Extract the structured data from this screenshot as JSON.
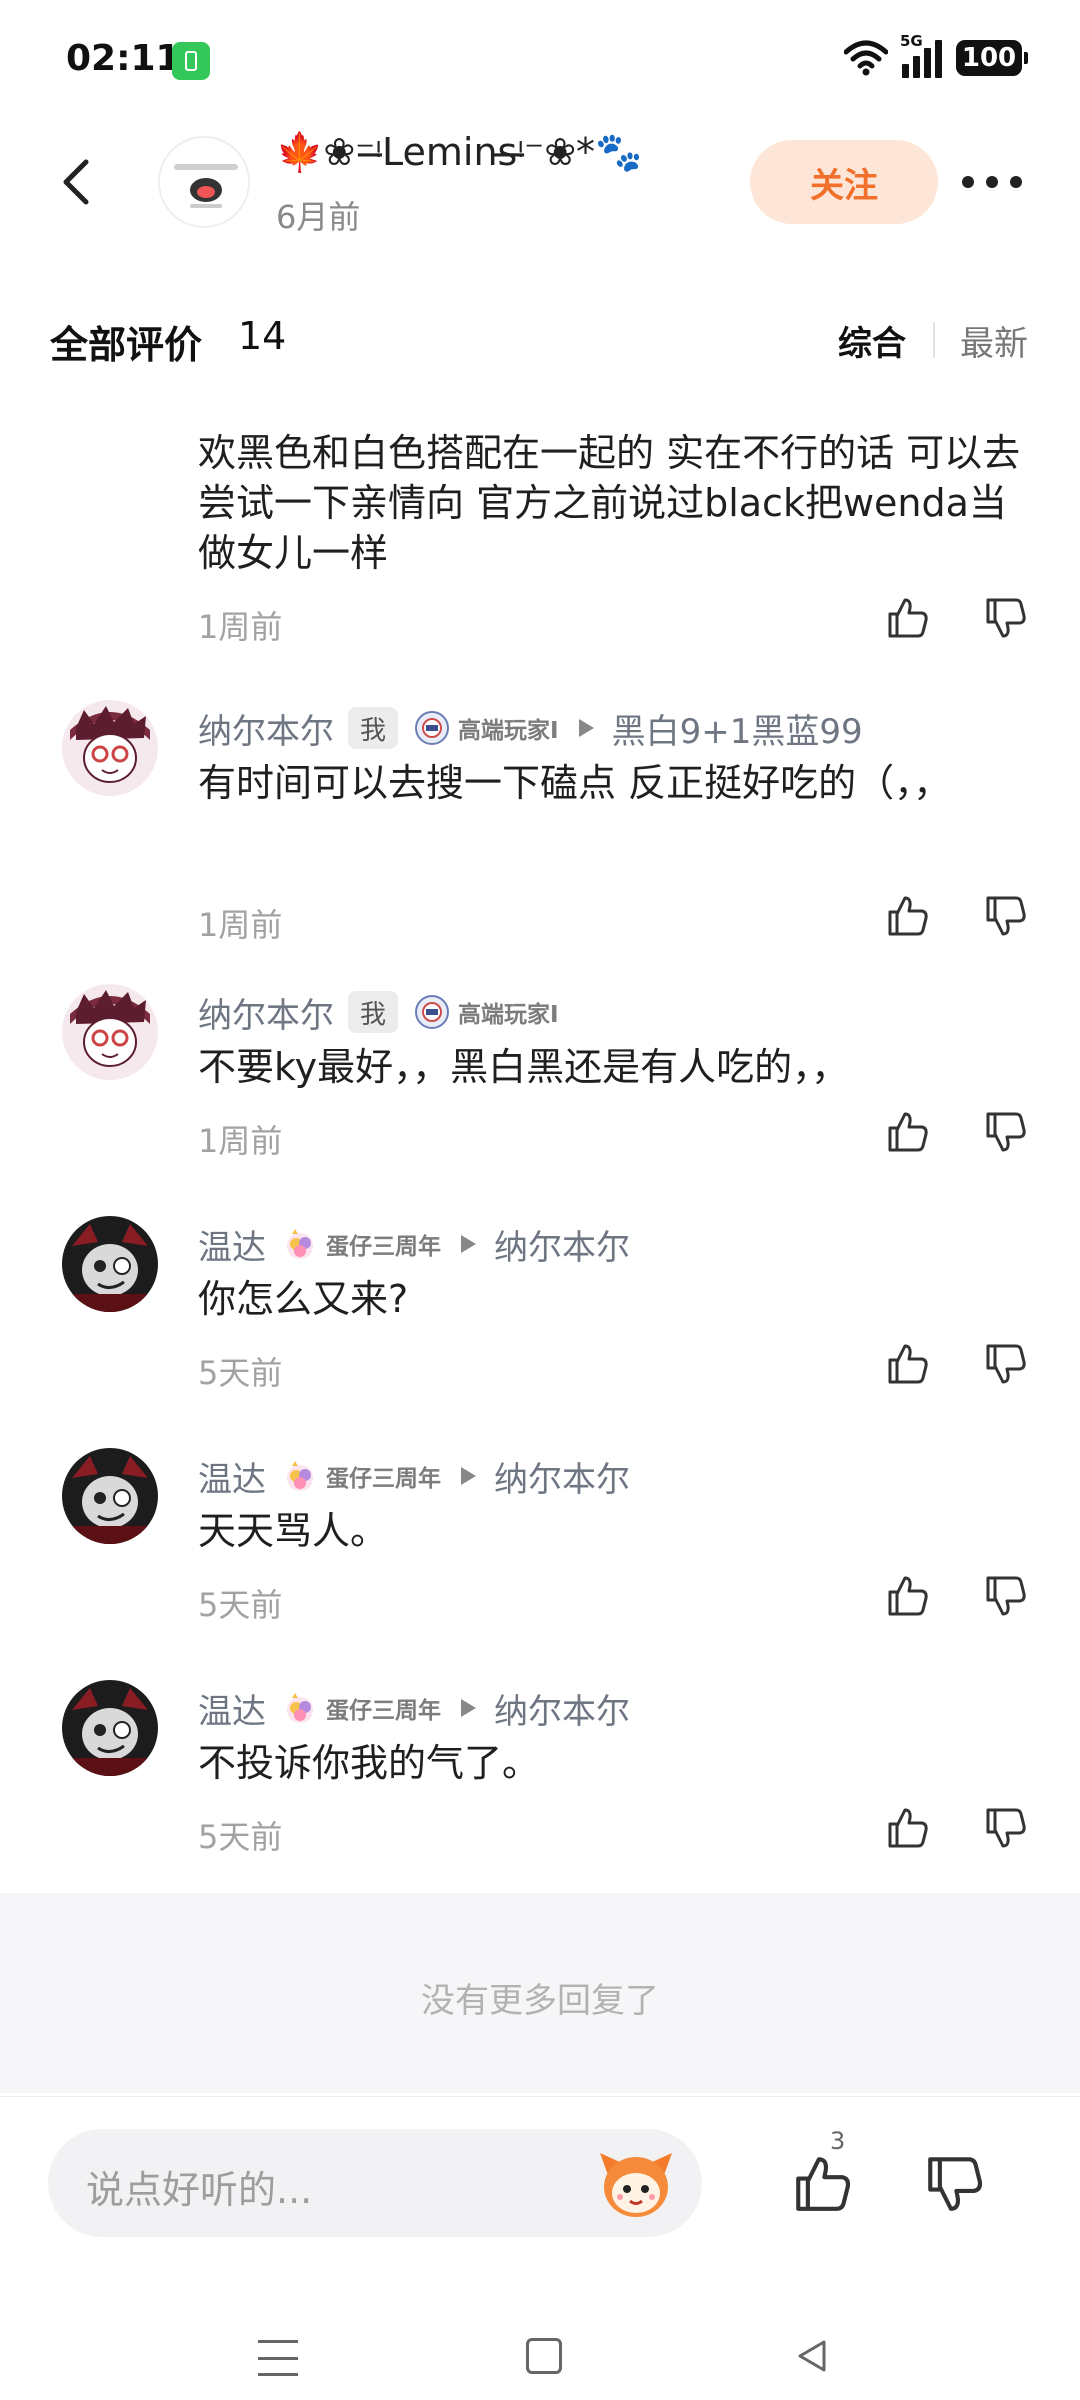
{
  "status_bar": {
    "time": "02:11",
    "network": "5G",
    "battery": "100"
  },
  "header": {
    "author_name": "🍁❀⁻ᵎ̶Lemins̶ᵎ̶⁻❀*🐾",
    "post_time": "6月前",
    "follow_label": "关注",
    "accent_color": "#f0702c",
    "follow_bg": "#fde6d8"
  },
  "section": {
    "title": "全部评价",
    "count": "14",
    "sort_options": [
      "综合",
      "最新"
    ]
  },
  "partial_comment": {
    "text": "欢黑色和白色搭配在一起的 实在不行的话 可以去尝试一下亲情向 官方之前说过black把wenda当做女儿一样",
    "time": "1周前"
  },
  "comments": [
    {
      "name": "纳尔本尔",
      "me_tag": "我",
      "badge": "高端玩家I",
      "reply_to": "黑白9+1黑蓝99",
      "text": "有时间可以去搜一下磕点 反正挺好吃的（，，",
      "time": "1周前"
    },
    {
      "name": "纳尔本尔",
      "me_tag": "我",
      "badge": "高端玩家I",
      "reply_to": "",
      "text": "不要ky最好，，黑白黑还是有人吃的，，",
      "time": "1周前"
    },
    {
      "name": "温达",
      "badge": "蛋仔三周年",
      "reply_to": "纳尔本尔",
      "text": "你怎么又来?",
      "time": "5天前"
    },
    {
      "name": "温达",
      "badge": "蛋仔三周年",
      "reply_to": "纳尔本尔",
      "text": "天天骂人。",
      "time": "5天前"
    },
    {
      "name": "温达",
      "badge": "蛋仔三周年",
      "reply_to": "纳尔本尔",
      "text": "不投诉你我的气了。",
      "time": "5天前"
    }
  ],
  "end_note": "没有更多回复了",
  "input_bar": {
    "placeholder": "说点好听的...",
    "like_count": "3"
  },
  "icons": {
    "back": "back-arrow-icon",
    "more": "more-dots-icon",
    "like": "thumbs-up-icon",
    "dislike": "thumbs-down-icon",
    "emoji": "emoji-sticker-icon",
    "nav_menu": "menu-icon",
    "nav_home": "home-square-icon",
    "nav_back": "back-triangle-icon"
  }
}
